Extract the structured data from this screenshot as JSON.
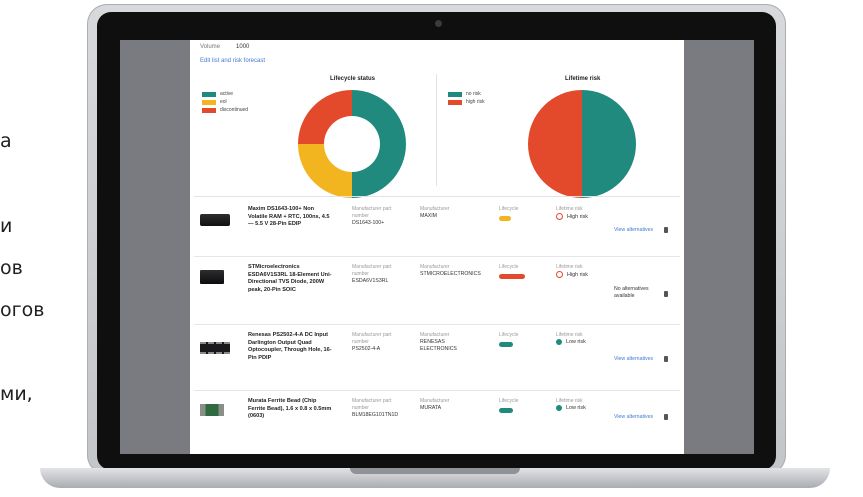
{
  "left_text": [
    "a",
    "и",
    "ов",
    "огов",
    "ми,"
  ],
  "app": {
    "volume_label": "Volume",
    "volume_value": "1000",
    "edit_link": "Edit list and risk forecast"
  },
  "colors": {
    "active": "#1f8a7d",
    "eol": "#f2b51f",
    "discontinued": "#e24a2b",
    "no_risk": "#1f8a7d",
    "high_risk": "#e24a2b",
    "link": "#3f7bd0"
  },
  "lifecycle_chart": {
    "title": "Lifecycle status",
    "legend": [
      "active",
      "eol",
      "discontinued"
    ]
  },
  "lifetime_chart": {
    "title": "Lifetime risk",
    "legend": [
      "no risk",
      "high risk"
    ]
  },
  "chart_data": [
    {
      "type": "pie",
      "title": "Lifecycle status",
      "donut": true,
      "categories": [
        "active",
        "eol",
        "discontinued"
      ],
      "values": [
        50,
        25,
        25
      ],
      "colors": [
        "#1f8a7d",
        "#f2b51f",
        "#e24a2b"
      ]
    },
    {
      "type": "pie",
      "title": "Lifetime risk",
      "donut": false,
      "categories": [
        "no risk",
        "high risk"
      ],
      "values": [
        50,
        50
      ],
      "colors": [
        "#1f8a7d",
        "#e24a2b"
      ]
    }
  ],
  "column_labels": {
    "mpn": "Manufacturer part number",
    "manufacturer": "Manufacturer",
    "lifecycle": "Lifecycle",
    "risk": "Lifetime risk"
  },
  "rows": [
    {
      "name": "Maxim DS1643-100+ Non Volatile RAM + RTC, 100ns, 4.5 — 5.5 V 28-Pin EDIP",
      "mpn": "DS1643-100+",
      "manufacturer": "MAXIM",
      "lifecycle_color": "#f2b51f",
      "risk_text": "High risk",
      "risk_icon": "no-entry-icon",
      "action": "View alternatives"
    },
    {
      "name": "STMicroelectronics ESDA6V1S3RL 18-Element Uni-Directional TVS Diode, 200W peak, 20-Pin SOIC",
      "mpn": "ESDA6V1S3RL",
      "manufacturer": "STMICROELECTRONICS",
      "lifecycle_color": "#e24a2b",
      "risk_text": "High risk",
      "risk_icon": "no-entry-icon",
      "action": "No alternatives available"
    },
    {
      "name": "Renesas PS2502-4-A DC Input Darlington Output Quad Optocoupler, Through Hole, 16-Pin PDIP",
      "mpn": "PS2502-4-A",
      "manufacturer": "RENESAS ELECTRONICS",
      "lifecycle_color": "#1f8a7d",
      "risk_text": "Low risk",
      "risk_icon": "check-circle-icon",
      "action": "View alternatives"
    },
    {
      "name": "Murata Ferrite Bead (Chip Ferrite Bead), 1.6 x 0.8 x 0.5mm (0603)",
      "mpn": "BLM18EG101TN1D",
      "manufacturer": "MURATA",
      "lifecycle_color": "#1f8a7d",
      "risk_text": "Low risk",
      "risk_icon": "check-circle-icon",
      "action": "View alternatives"
    }
  ]
}
